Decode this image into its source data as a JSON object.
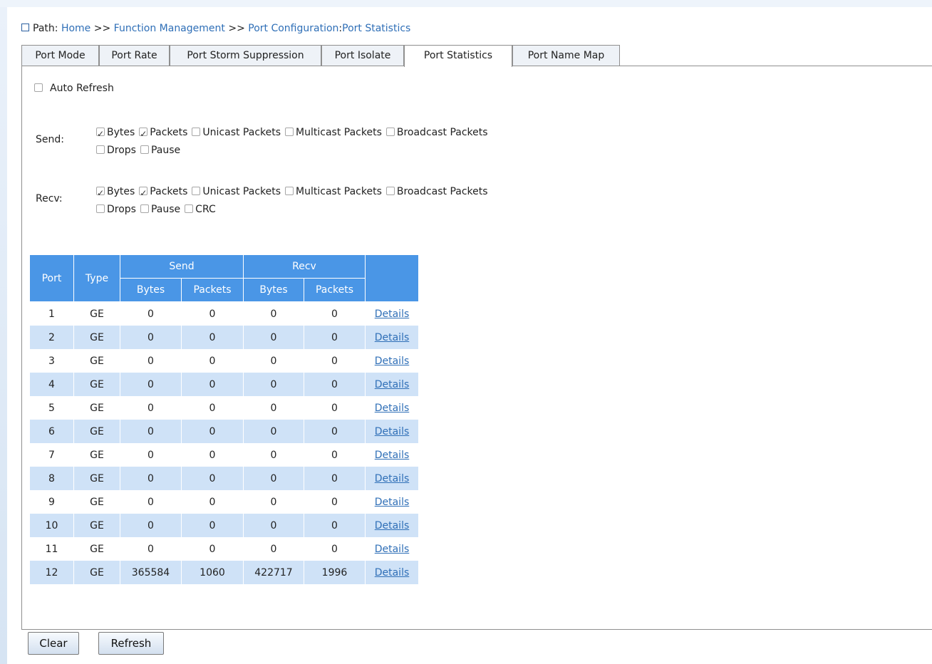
{
  "breadcrumb": {
    "label": "Path:",
    "items": [
      "Home",
      "Function Management",
      "Port Configuration",
      "Port Statistics"
    ],
    "separators": [
      ">>",
      ">>",
      ":"
    ]
  },
  "tabs": [
    {
      "label": "Port Mode",
      "active": false
    },
    {
      "label": "Port Rate",
      "active": false
    },
    {
      "label": "Port Storm Suppression",
      "active": false
    },
    {
      "label": "Port Isolate",
      "active": false
    },
    {
      "label": "Port Statistics",
      "active": true
    },
    {
      "label": "Port Name Map",
      "active": false
    }
  ],
  "auto_refresh": {
    "label": "Auto Refresh",
    "checked": false
  },
  "send": {
    "label": "Send:",
    "options": [
      {
        "label": "Bytes",
        "checked": true
      },
      {
        "label": "Packets",
        "checked": true
      },
      {
        "label": "Unicast Packets",
        "checked": false
      },
      {
        "label": "Multicast Packets",
        "checked": false
      },
      {
        "label": "Broadcast Packets",
        "checked": false
      },
      {
        "label": "Drops",
        "checked": false
      },
      {
        "label": "Pause",
        "checked": false
      }
    ]
  },
  "recv": {
    "label": "Recv:",
    "options": [
      {
        "label": "Bytes",
        "checked": true
      },
      {
        "label": "Packets",
        "checked": true
      },
      {
        "label": "Unicast Packets",
        "checked": false
      },
      {
        "label": "Multicast Packets",
        "checked": false
      },
      {
        "label": "Broadcast Packets",
        "checked": false
      },
      {
        "label": "Drops",
        "checked": false
      },
      {
        "label": "Pause",
        "checked": false
      },
      {
        "label": "CRC",
        "checked": false
      }
    ]
  },
  "table": {
    "headers": {
      "port": "Port",
      "type": "Type",
      "send": "Send",
      "recv": "Recv",
      "send_bytes": "Bytes",
      "send_packets": "Packets",
      "recv_bytes": "Bytes",
      "recv_packets": "Packets"
    },
    "details_label": "Details",
    "rows": [
      {
        "port": "1",
        "type": "GE",
        "send_bytes": "0",
        "send_packets": "0",
        "recv_bytes": "0",
        "recv_packets": "0"
      },
      {
        "port": "2",
        "type": "GE",
        "send_bytes": "0",
        "send_packets": "0",
        "recv_bytes": "0",
        "recv_packets": "0"
      },
      {
        "port": "3",
        "type": "GE",
        "send_bytes": "0",
        "send_packets": "0",
        "recv_bytes": "0",
        "recv_packets": "0"
      },
      {
        "port": "4",
        "type": "GE",
        "send_bytes": "0",
        "send_packets": "0",
        "recv_bytes": "0",
        "recv_packets": "0"
      },
      {
        "port": "5",
        "type": "GE",
        "send_bytes": "0",
        "send_packets": "0",
        "recv_bytes": "0",
        "recv_packets": "0"
      },
      {
        "port": "6",
        "type": "GE",
        "send_bytes": "0",
        "send_packets": "0",
        "recv_bytes": "0",
        "recv_packets": "0"
      },
      {
        "port": "7",
        "type": "GE",
        "send_bytes": "0",
        "send_packets": "0",
        "recv_bytes": "0",
        "recv_packets": "0"
      },
      {
        "port": "8",
        "type": "GE",
        "send_bytes": "0",
        "send_packets": "0",
        "recv_bytes": "0",
        "recv_packets": "0"
      },
      {
        "port": "9",
        "type": "GE",
        "send_bytes": "0",
        "send_packets": "0",
        "recv_bytes": "0",
        "recv_packets": "0"
      },
      {
        "port": "10",
        "type": "GE",
        "send_bytes": "0",
        "send_packets": "0",
        "recv_bytes": "0",
        "recv_packets": "0"
      },
      {
        "port": "11",
        "type": "GE",
        "send_bytes": "0",
        "send_packets": "0",
        "recv_bytes": "0",
        "recv_packets": "0"
      },
      {
        "port": "12",
        "type": "GE",
        "send_bytes": "365584",
        "send_packets": "1060",
        "recv_bytes": "422717",
        "recv_packets": "1996"
      }
    ]
  },
  "buttons": {
    "clear": "Clear",
    "refresh": "Refresh"
  },
  "colors": {
    "header_blue": "#4a96e6",
    "row_stripe": "#cfe2f7",
    "link": "#2f6fb7"
  }
}
